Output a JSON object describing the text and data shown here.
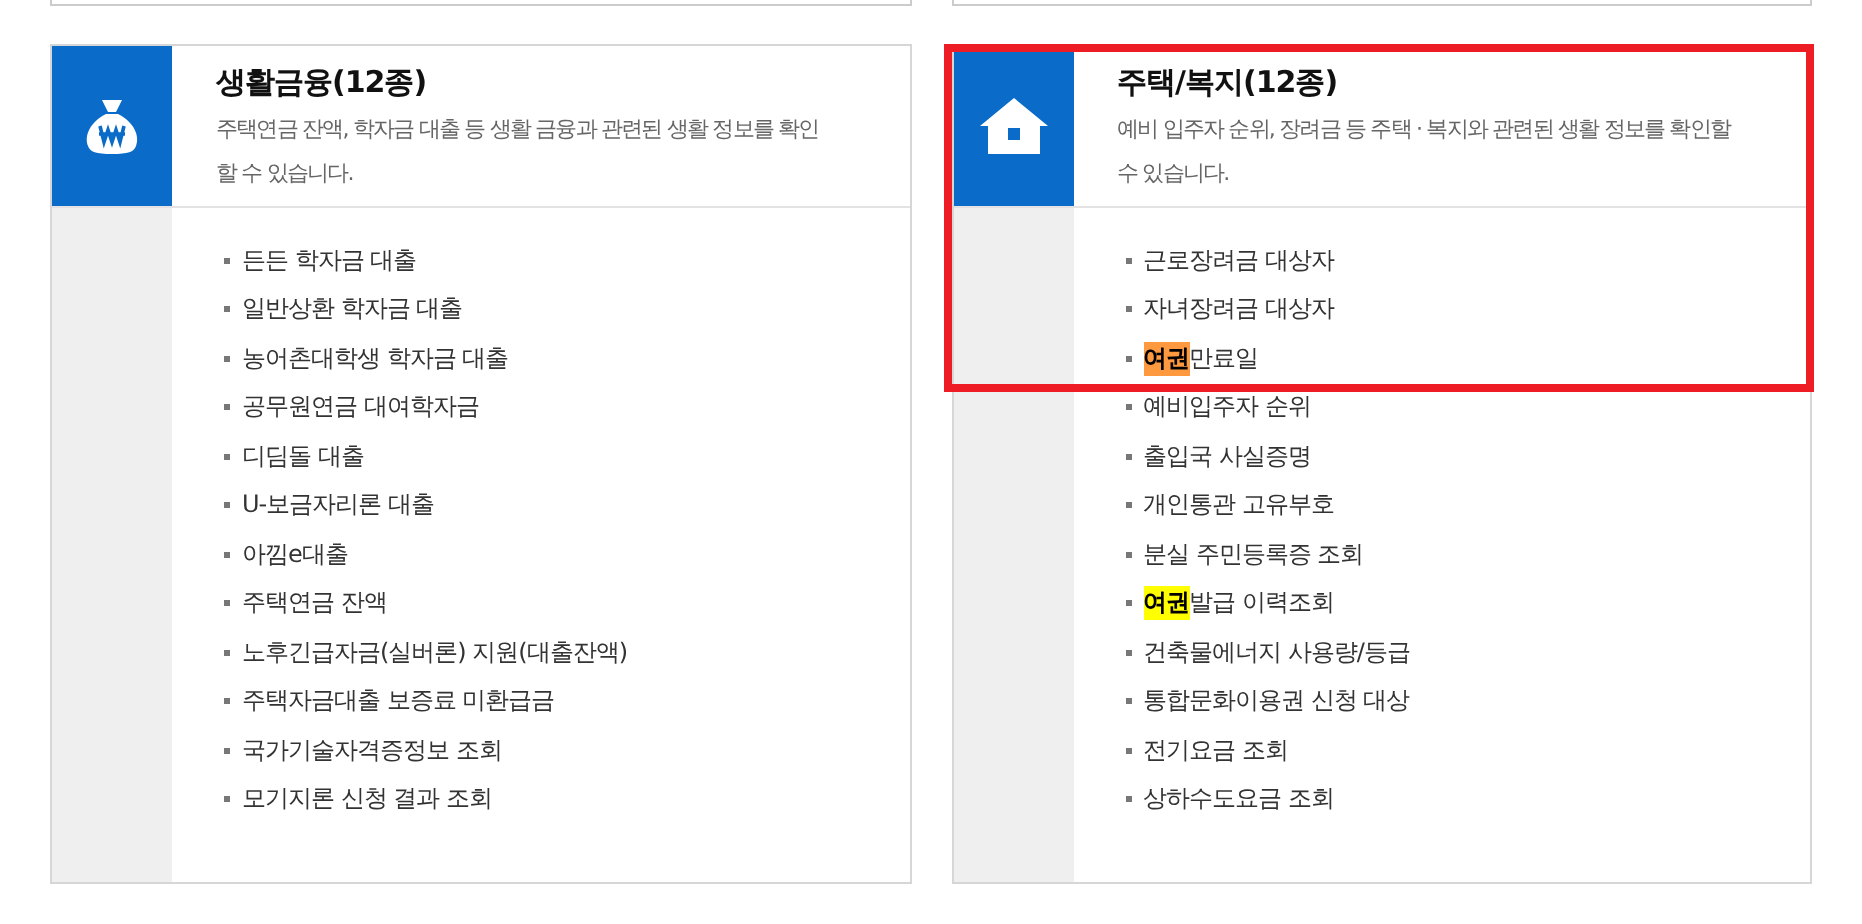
{
  "cards": [
    {
      "title": "생활금융(12종)",
      "description": "주택연금 잔액, 학자금 대출 등 생활 금융과 관련된 생활 정보를 확인할 수 있습니다.",
      "item_groups": [
        {
          "framed": false,
          "items": [
            {
              "parts": [
                {
                  "text": "든든 학자금 대출"
                }
              ]
            },
            {
              "parts": [
                {
                  "text": "일반상환 학자금 대출"
                }
              ]
            },
            {
              "parts": [
                {
                  "text": "농어촌대학생 학자금 대출"
                }
              ]
            },
            {
              "parts": [
                {
                  "text": "공무원연금 대여학자금"
                }
              ]
            },
            {
              "parts": [
                {
                  "text": "디딤돌 대출"
                }
              ]
            },
            {
              "parts": [
                {
                  "text": "U-보금자리론 대출"
                }
              ]
            },
            {
              "parts": [
                {
                  "text": "아낌e대출"
                }
              ]
            },
            {
              "parts": [
                {
                  "text": "주택연금 잔액"
                }
              ]
            },
            {
              "parts": [
                {
                  "text": "노후긴급자금(실버론) 지원(대출잔액)"
                }
              ]
            },
            {
              "parts": [
                {
                  "text": "주택자금대출 보증료 미환급금"
                }
              ]
            },
            {
              "parts": [
                {
                  "text": "국가기술자격증정보 조회"
                }
              ]
            },
            {
              "parts": [
                {
                  "text": "모기지론 신청 결과 조회"
                }
              ]
            }
          ]
        }
      ]
    },
    {
      "title": "주택/복지(12종)",
      "description": "예비 입주자 순위, 장려금 등 주택 · 복지와 관련된 생활 정보를 확인할 수 있습니다.",
      "item_groups": [
        {
          "framed": true,
          "items": [
            {
              "parts": [
                {
                  "text": "근로장려금 대상자"
                }
              ]
            },
            {
              "parts": [
                {
                  "text": "자녀장려금 대상자"
                }
              ]
            },
            {
              "parts": [
                {
                  "text": "여권",
                  "color": "#ff9940"
                },
                {
                  "text": "만료일"
                }
              ]
            }
          ]
        },
        {
          "framed": false,
          "items": [
            {
              "parts": [
                {
                  "text": "예비입주자 순위"
                }
              ]
            },
            {
              "parts": [
                {
                  "text": "출입국 사실증명"
                }
              ]
            },
            {
              "parts": [
                {
                  "text": "개인통관 고유부호"
                }
              ]
            },
            {
              "parts": [
                {
                  "text": "분실 주민등록증 조회"
                }
              ]
            },
            {
              "parts": [
                {
                  "text": "여권",
                  "color": "#ffff00"
                },
                {
                  "text": "발급 이력조회"
                }
              ]
            },
            {
              "parts": [
                {
                  "text": "건축물에너지 사용량/등급"
                }
              ]
            },
            {
              "parts": [
                {
                  "text": "통합문화이용권 신청 대상"
                }
              ]
            },
            {
              "parts": [
                {
                  "text": "전기요금 조회"
                }
              ]
            },
            {
              "parts": [
                {
                  "text": "상하수도요금 조회"
                }
              ]
            }
          ]
        }
      ]
    }
  ]
}
